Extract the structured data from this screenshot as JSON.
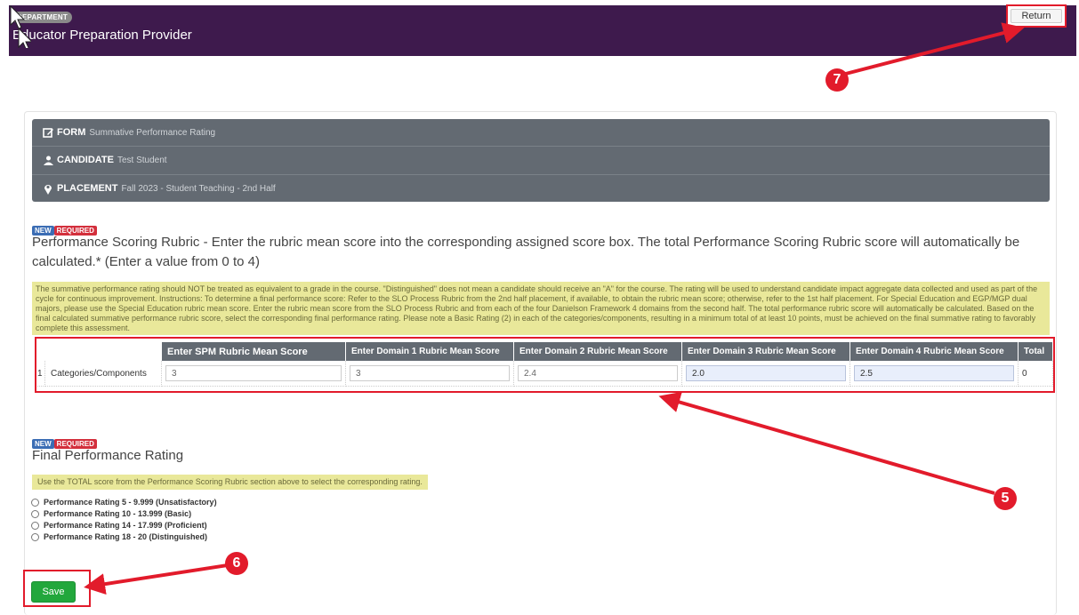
{
  "header": {
    "department_badge": "DEPARTMENT",
    "title": "Educator Preparation Provider",
    "return_label": "Return"
  },
  "info": {
    "form_label": "FORM",
    "form_value": "Summative Performance Rating",
    "candidate_label": "CANDIDATE",
    "candidate_value": "Test Student",
    "placement_label": "PLACEMENT",
    "placement_value": "Fall 2023 - Student Teaching - 2nd Half"
  },
  "badges": {
    "new": "NEW",
    "required": "REQUIRED"
  },
  "rubric": {
    "title": "Performance Scoring Rubric - Enter the rubric mean score into the corresponding assigned score box. The total Performance Scoring Rubric score will automatically be calculated.* (Enter a value from 0 to 4)",
    "note": "The summative performance rating should NOT be treated as equivalent to a grade in the course. \"Distinguished\" does not mean a candidate should receive an \"A\" for the course. The rating will be used to understand candidate impact aggregate data collected and used as part of the cycle for continuous improvement. Instructions: To determine a final performance score: Refer to the SLO Process Rubric from the 2nd half placement, if available, to obtain the rubric mean score; otherwise, refer to the 1st half placement. For Special Education and EGP/MGP dual majors, please use the Special Education rubric mean score. Enter the rubric mean score from the SLO Process Rubric and from each of the four Danielson Framework 4 domains from the second half. The total performance rubric score will automatically be calculated. Based on the final calculated summative performance rubric score, select the corresponding final performance rating. Please note a Basic Rating (2) in each of the categories/components, resulting in a minimum total of at least 10 points, must be achieved on the final summative rating to favorably complete this assessment.",
    "headers": [
      "Enter SPM Rubric Mean Score",
      "Enter Domain 1 Rubric Mean Score",
      "Enter Domain 2 Rubric Mean Score",
      "Enter Domain 3 Rubric Mean Score",
      "Enter Domain 4 Rubric Mean Score",
      "Total"
    ],
    "row": {
      "index": "1",
      "label": "Categories/Components",
      "values": [
        "3",
        "3",
        "2.4",
        "2.0",
        "2.5"
      ],
      "total": "0"
    }
  },
  "final_rating": {
    "title": "Final Performance Rating",
    "note": "Use the TOTAL score from the Performance Scoring Rubric section above to select the corresponding rating.",
    "options": [
      "Performance Rating 5 - 9.999 (Unsatisfactory)",
      "Performance Rating 10 - 13.999 (Basic)",
      "Performance Rating 14 - 17.999 (Proficient)",
      "Performance Rating 18 - 20 (Distinguished)"
    ]
  },
  "save_label": "Save",
  "callouts": {
    "c5": "5",
    "c6": "6",
    "c7": "7"
  },
  "colors": {
    "header_bg": "#3e1a4d",
    "panel_bg": "#636a72",
    "note_bg": "#e9e89a",
    "save_green": "#22a73c",
    "callout_red": "#e21b2b"
  }
}
